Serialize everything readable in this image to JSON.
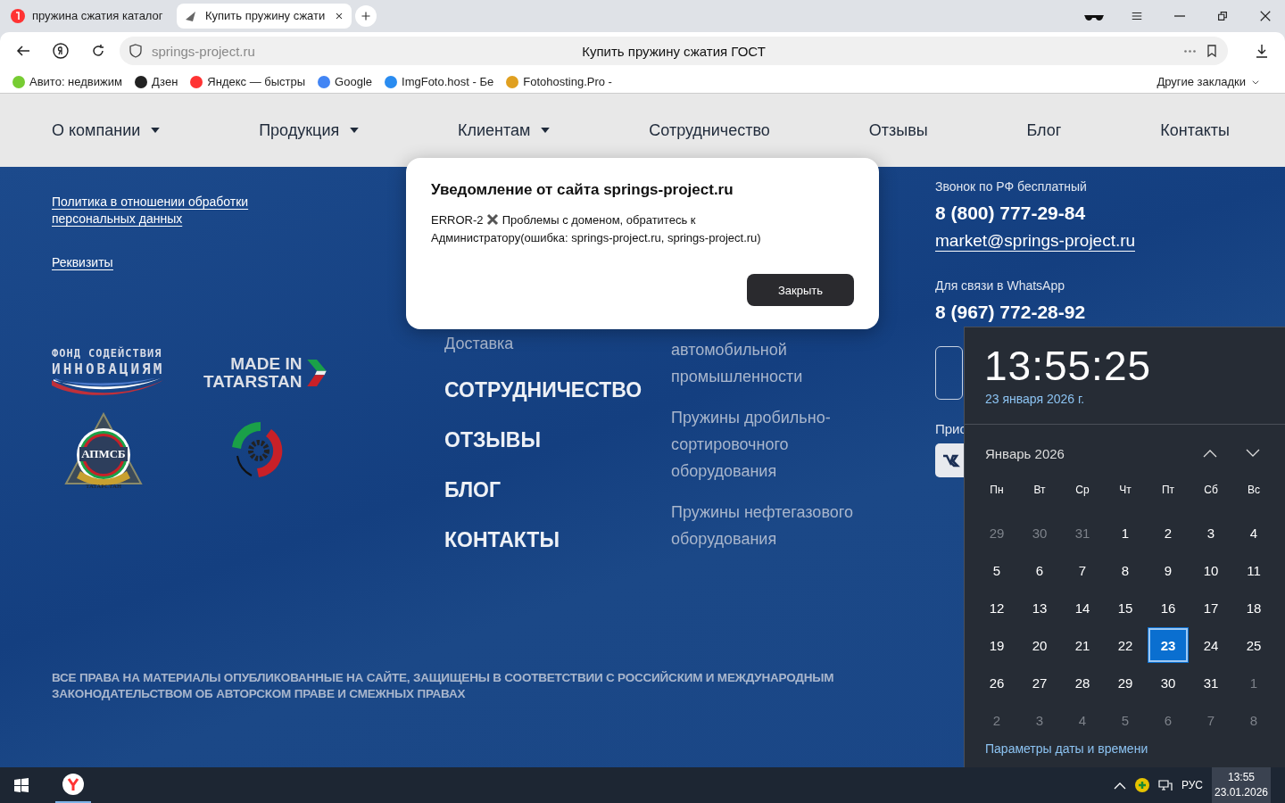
{
  "browser": {
    "tabs": [
      {
        "title": "пружина сжатия каталог",
        "selected": false
      },
      {
        "title": "Купить пружину сжати",
        "selected": true
      }
    ],
    "address": {
      "url": "springs-project.ru",
      "page_title": "Купить пружину сжатия ГОСТ"
    },
    "bookmarks": [
      "Авито: недвижим",
      "Дзен",
      "Яндекс — быстры",
      "Google",
      "ImgFoto.host - Бе",
      "Fotohosting.Pro -"
    ],
    "other_bookmarks": "Другие закладки"
  },
  "site_nav": [
    {
      "label": "О компании",
      "dropdown": true
    },
    {
      "label": "Продукция",
      "dropdown": true
    },
    {
      "label": "Клиентам",
      "dropdown": true
    },
    {
      "label": "Сотрудничество",
      "dropdown": false
    },
    {
      "label": "Отзывы",
      "dropdown": false
    },
    {
      "label": "Блог",
      "dropdown": false
    },
    {
      "label": "Контакты",
      "dropdown": false
    }
  ],
  "footer": {
    "policy_links": [
      "Политика в отношении обработки персональных данных",
      "Реквизиты"
    ],
    "logos": {
      "fund": [
        "ФОНД СОДЕЙСТВИЯ",
        "ИННОВАЦИЯМ"
      ],
      "made_in": [
        "MADE IN",
        "TATARSTAN"
      ],
      "apmsb": "АПМСБ",
      "apmsb_ring": "ТАТАРСТАН"
    },
    "menu_sub": "Доставка",
    "menu_sections": [
      "СОТРУДНИЧЕСТВО",
      "ОТЗЫВЫ",
      "БЛОГ",
      "КОНТАКТЫ"
    ],
    "products": [
      "автомобильной промышленности",
      "Пружины дробильно-сортировочного оборудования",
      "Пружины нефтегазового оборудования"
    ],
    "contacts": {
      "free_call_label": "Звонок по РФ бесплатный",
      "phone": "8 (800) 777-29-84",
      "email": "market@springs-project.ru",
      "whatsapp_label": "Для связи в WhatsApp",
      "whatsapp_phone": "8 (967) 772-28-92",
      "join_label": "Прис"
    },
    "copyright": "ВСЕ ПРАВА НА МАТЕРИАЛЫ ОПУБЛИКОВАННЫЕ НА САЙТЕ, ЗАЩИЩЕНЫ В СООТВЕТСТВИИ С РОССИЙСКИМ И МЕЖДУНАРОДНЫМ ЗАКОНОДАТЕЛЬСТВОМ ОБ АВТОРСКОМ ПРАВЕ И СМЕЖНЫХ ПРАВАХ"
  },
  "dialog": {
    "title": "Уведомление от сайта springs-project.ru",
    "message_start": "ERROR-2",
    "message": "Проблемы с доменом, обратитесь к Администратору(ошибка: springs-project.ru, springs-project.ru)",
    "button": "Закрыть"
  },
  "calendar": {
    "time": "13:55:25",
    "date": "23 января 2026 г.",
    "month": "Январь 2026",
    "weekdays": [
      "Пн",
      "Вт",
      "Ср",
      "Чт",
      "Пт",
      "Сб",
      "Вс"
    ],
    "days": [
      {
        "label": "29",
        "other_month": true,
        "selected": false
      },
      {
        "label": "30",
        "other_month": true,
        "selected": false
      },
      {
        "label": "31",
        "other_month": true,
        "selected": false
      },
      {
        "label": "1",
        "other_month": false,
        "selected": false
      },
      {
        "label": "2",
        "other_month": false,
        "selected": false
      },
      {
        "label": "3",
        "other_month": false,
        "selected": false
      },
      {
        "label": "4",
        "other_month": false,
        "selected": false
      },
      {
        "label": "5",
        "other_month": false,
        "selected": false
      },
      {
        "label": "6",
        "other_month": false,
        "selected": false
      },
      {
        "label": "7",
        "other_month": false,
        "selected": false
      },
      {
        "label": "8",
        "other_month": false,
        "selected": false
      },
      {
        "label": "9",
        "other_month": false,
        "selected": false
      },
      {
        "label": "10",
        "other_month": false,
        "selected": false
      },
      {
        "label": "11",
        "other_month": false,
        "selected": false
      },
      {
        "label": "12",
        "other_month": false,
        "selected": false
      },
      {
        "label": "13",
        "other_month": false,
        "selected": false
      },
      {
        "label": "14",
        "other_month": false,
        "selected": false
      },
      {
        "label": "15",
        "other_month": false,
        "selected": false
      },
      {
        "label": "16",
        "other_month": false,
        "selected": false
      },
      {
        "label": "17",
        "other_month": false,
        "selected": false
      },
      {
        "label": "18",
        "other_month": false,
        "selected": false
      },
      {
        "label": "19",
        "other_month": false,
        "selected": false
      },
      {
        "label": "20",
        "other_month": false,
        "selected": false
      },
      {
        "label": "21",
        "other_month": false,
        "selected": false
      },
      {
        "label": "22",
        "other_month": false,
        "selected": false
      },
      {
        "label": "23",
        "other_month": false,
        "selected": true
      },
      {
        "label": "24",
        "other_month": false,
        "selected": false
      },
      {
        "label": "25",
        "other_month": false,
        "selected": false
      },
      {
        "label": "26",
        "other_month": false,
        "selected": false
      },
      {
        "label": "27",
        "other_month": false,
        "selected": false
      },
      {
        "label": "28",
        "other_month": false,
        "selected": false
      },
      {
        "label": "29",
        "other_month": false,
        "selected": false
      },
      {
        "label": "30",
        "other_month": false,
        "selected": false
      },
      {
        "label": "31",
        "other_month": false,
        "selected": false
      },
      {
        "label": "1",
        "other_month": true,
        "selected": false
      },
      {
        "label": "2",
        "other_month": true,
        "selected": false
      },
      {
        "label": "3",
        "other_month": true,
        "selected": false
      },
      {
        "label": "4",
        "other_month": true,
        "selected": false
      },
      {
        "label": "5",
        "other_month": true,
        "selected": false
      },
      {
        "label": "6",
        "other_month": true,
        "selected": false
      },
      {
        "label": "7",
        "other_month": true,
        "selected": false
      },
      {
        "label": "8",
        "other_month": true,
        "selected": false
      }
    ],
    "settings_link": "Параметры даты и времени"
  },
  "taskbar": {
    "language": "РУС",
    "time": "13:55",
    "date": "23.01.2026"
  }
}
